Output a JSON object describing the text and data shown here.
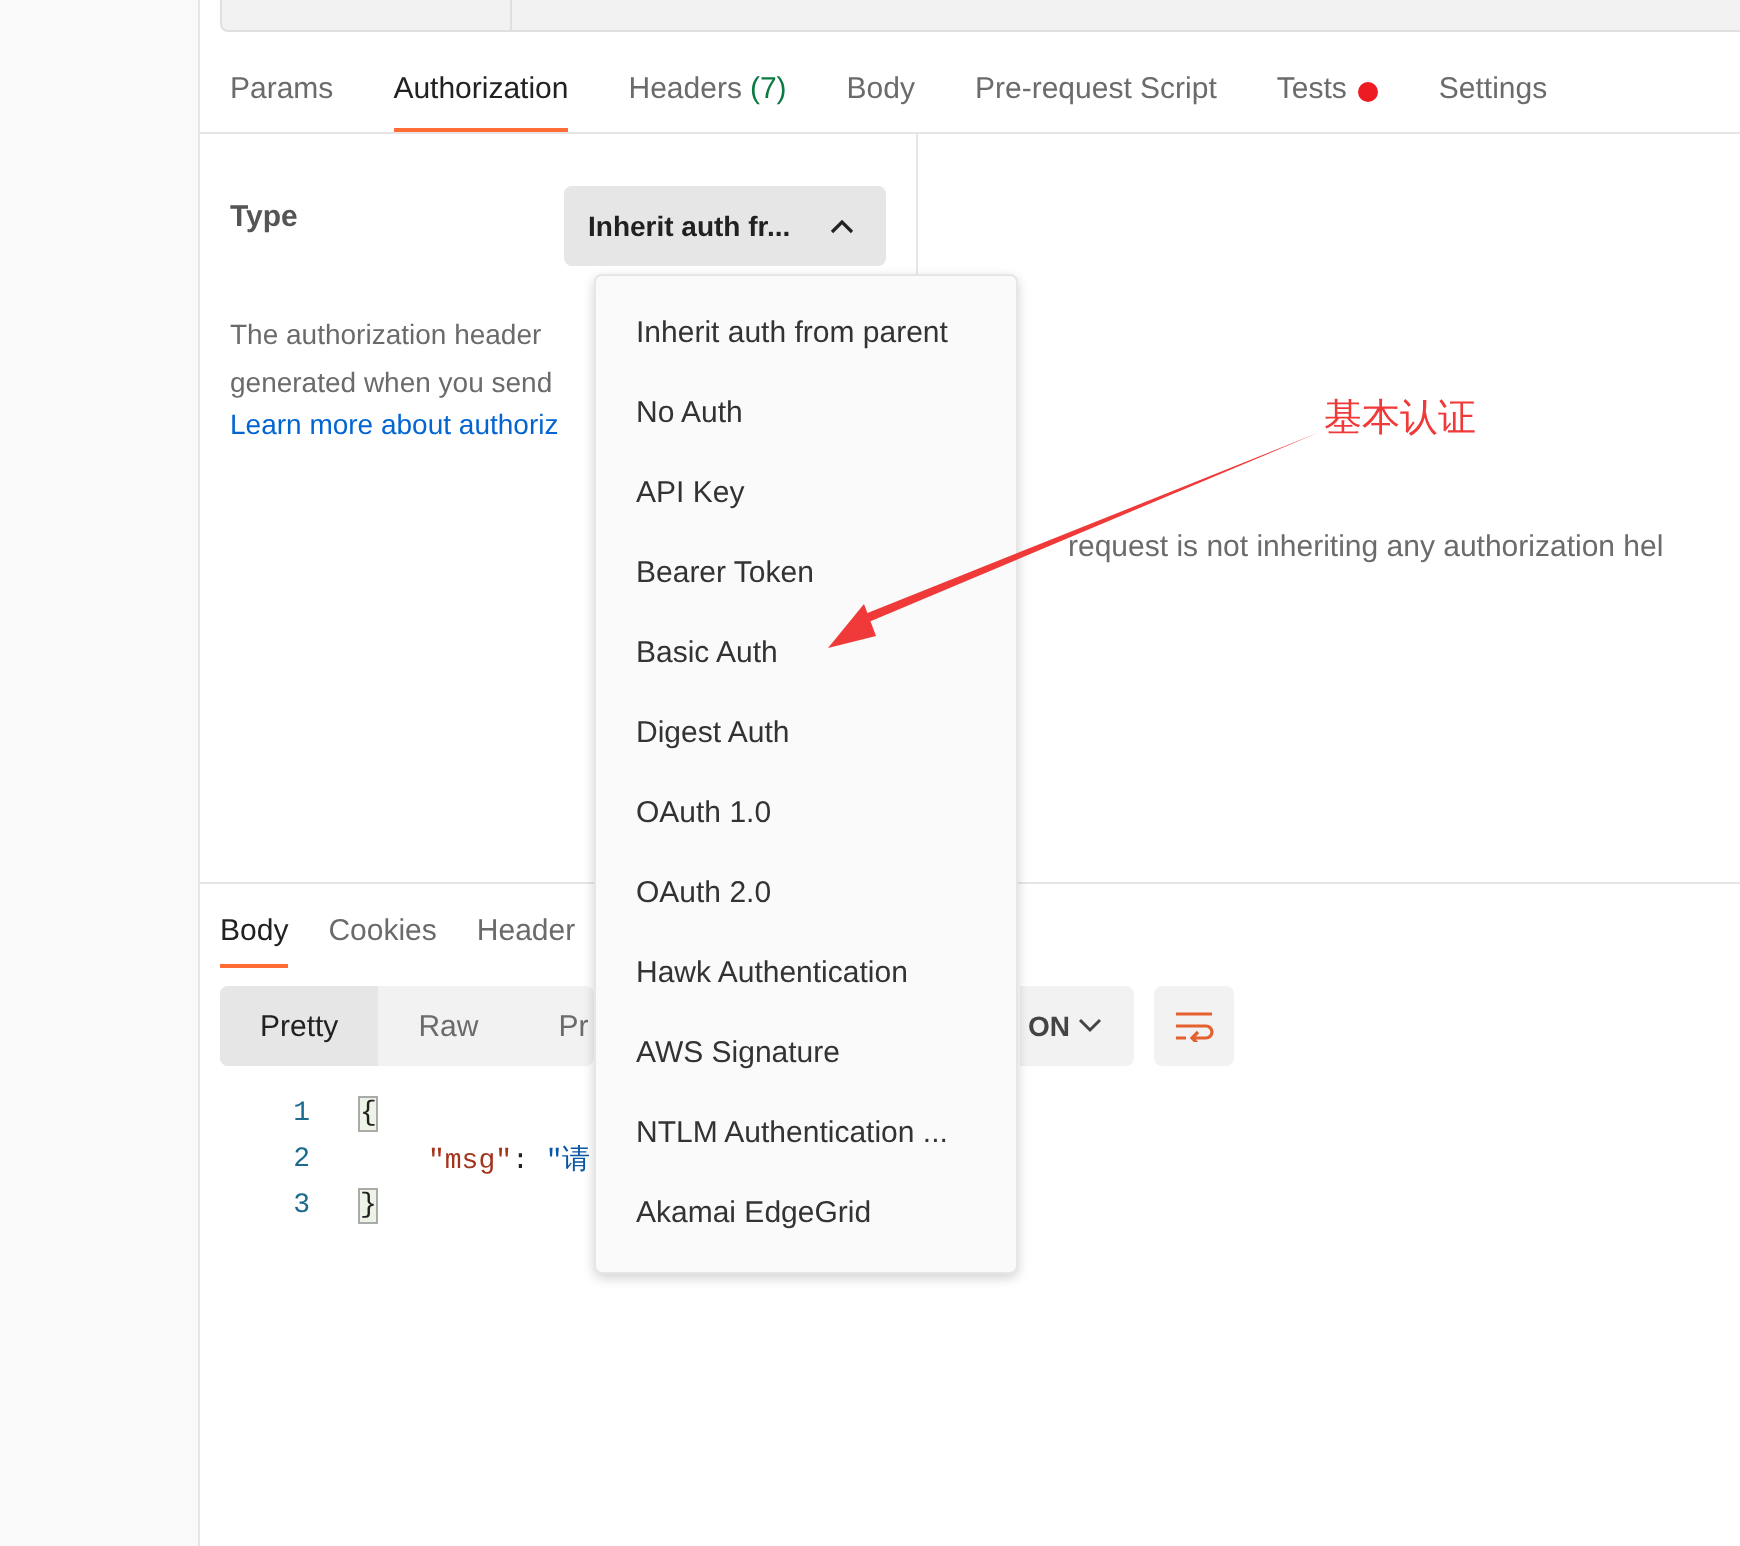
{
  "request_tabs": [
    {
      "label": "Params",
      "selected": false,
      "dot": false
    },
    {
      "label": "Authorization",
      "selected": true,
      "dot": false
    },
    {
      "label": "Headers",
      "selected": false,
      "count": "(7)",
      "dot": false
    },
    {
      "label": "Body",
      "selected": false,
      "dot": false
    },
    {
      "label": "Pre-request Script",
      "selected": false,
      "dot": false
    },
    {
      "label": "Tests",
      "selected": false,
      "dot": true
    },
    {
      "label": "Settings",
      "selected": false,
      "dot": false
    }
  ],
  "auth": {
    "type_label": "Type",
    "type_value": "Inherit auth fr...",
    "expanded": true,
    "description_lines": [
      "The authorization header",
      "generated when you send"
    ],
    "link": "Learn more about authoriz"
  },
  "auth_menu": [
    "Inherit auth from parent",
    "No Auth",
    "API Key",
    "Bearer Token",
    "Basic Auth",
    "Digest Auth",
    "OAuth 1.0",
    "OAuth 2.0",
    "Hawk Authentication",
    "AWS Signature",
    "NTLM Authentication ...",
    "Akamai EdgeGrid"
  ],
  "auth_message": "request is not inheriting any authorization hel",
  "annotation": {
    "text": "基本认证"
  },
  "response": {
    "tabs": [
      {
        "label": "Body",
        "selected": true
      },
      {
        "label": "Cookies",
        "selected": false
      },
      {
        "label": "Header",
        "selected": false
      }
    ],
    "view_modes": [
      {
        "label": "Pretty",
        "selected": true
      },
      {
        "label": "Raw",
        "selected": false
      },
      {
        "label": "Pr",
        "selected": false
      }
    ],
    "format": "ON",
    "code_lines": [
      {
        "number": "1",
        "parts": [
          {
            "kind": "bracket",
            "text": "{"
          }
        ]
      },
      {
        "number": "2",
        "parts": [
          {
            "kind": "key",
            "text": "\"msg\""
          },
          {
            "kind": "punct",
            "text": ": "
          },
          {
            "kind": "string",
            "text": "\"请"
          }
        ],
        "indented": true
      },
      {
        "number": "3",
        "parts": [
          {
            "kind": "bracket",
            "text": "}"
          }
        ]
      }
    ]
  }
}
